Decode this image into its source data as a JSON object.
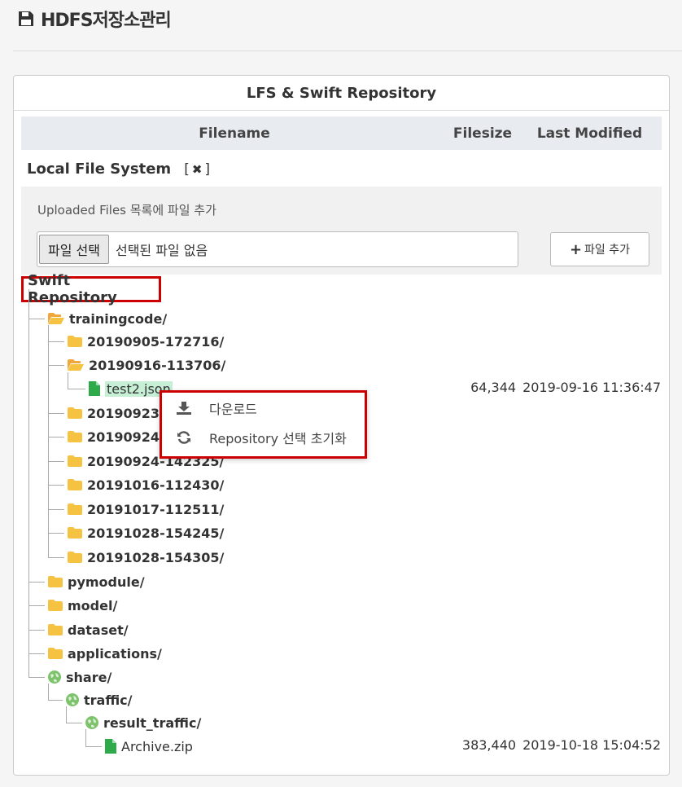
{
  "page": {
    "title": "HDFS저장소관리"
  },
  "panel": {
    "title": "LFS & Swift Repository"
  },
  "columns": {
    "filename": "Filename",
    "filesize": "Filesize",
    "modified": "Last Modified"
  },
  "lfs": {
    "title": "Local File System",
    "close_open": "[",
    "close_close": "]",
    "upload_label": "Uploaded Files 목록에 파일 추가",
    "choose_button": "파일 선택",
    "no_file": "선택된 파일 없음",
    "add_button": "파일 추가"
  },
  "swift": {
    "title": "Swift Repository",
    "tree": [
      {
        "label": "trainingcode/",
        "icon": "folder-open-icon"
      },
      {
        "label": "20190905-172716/",
        "icon": "folder-icon"
      },
      {
        "label": "20190916-113706/",
        "icon": "folder-open-icon"
      },
      {
        "label": "test2.json",
        "icon": "file-icon",
        "filesize": "64,344",
        "modified": "2019-09-16 11:36:47"
      },
      {
        "label": "20190923-163406/",
        "icon": "folder-icon"
      },
      {
        "label": "20190924-105302/",
        "icon": "folder-icon"
      },
      {
        "label": "20190924-142325/",
        "icon": "folder-icon"
      },
      {
        "label": "20191016-112430/",
        "icon": "folder-icon"
      },
      {
        "label": "20191017-112511/",
        "icon": "folder-icon"
      },
      {
        "label": "20191028-154245/",
        "icon": "folder-icon"
      },
      {
        "label": "20191028-154305/",
        "icon": "folder-icon"
      },
      {
        "label": "pymodule/",
        "icon": "folder-icon"
      },
      {
        "label": "model/",
        "icon": "folder-icon"
      },
      {
        "label": "dataset/",
        "icon": "folder-icon"
      },
      {
        "label": "applications/",
        "icon": "folder-icon"
      },
      {
        "label": "share/",
        "icon": "globe-icon"
      },
      {
        "label": "traffic/",
        "icon": "globe-icon"
      },
      {
        "label": "result_traffic/",
        "icon": "globe-icon"
      },
      {
        "label": "Archive.zip",
        "icon": "file-icon",
        "filesize": "383,440",
        "modified": "2019-10-18 15:04:52"
      }
    ]
  },
  "context_menu": {
    "download": "다운로드",
    "reset": "Repository 선택 초기화"
  },
  "colors": {
    "highlight": "#cc0000",
    "folder": "#f5c242",
    "file": "#2eaa4a",
    "globe": "#7cc36b"
  }
}
